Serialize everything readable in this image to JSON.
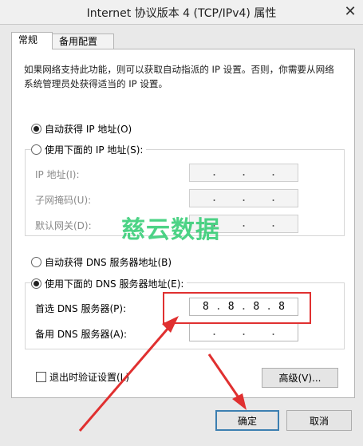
{
  "window": {
    "title": "Internet 协议版本 4 (TCP/IPv4) 属性",
    "close_glyph": "✕"
  },
  "tabs": [
    {
      "label": "常规",
      "active": true
    },
    {
      "label": "备用配置",
      "active": false
    }
  ],
  "description": "如果网络支持此功能，则可以获取自动指派的 IP 设置。否则，你需要从网络系统管理员处获得适当的 IP 设置。",
  "ip": {
    "auto_label": "自动获得 IP 地址(O)",
    "auto_selected": true,
    "manual_label": "使用下面的 IP 地址(S):",
    "manual_selected": false,
    "fields": [
      {
        "label": "IP 地址(I):",
        "octets": [
          "",
          "",
          "",
          ""
        ]
      },
      {
        "label": "子网掩码(U):",
        "octets": [
          "",
          "",
          "",
          ""
        ]
      },
      {
        "label": "默认网关(D):",
        "octets": [
          "",
          "",
          "",
          ""
        ]
      }
    ]
  },
  "dns": {
    "auto_label": "自动获得 DNS 服务器地址(B)",
    "auto_selected": false,
    "manual_label": "使用下面的 DNS 服务器地址(E):",
    "manual_selected": true,
    "preferred": {
      "label": "首选 DNS 服务器(P):",
      "octets": [
        "8",
        "8",
        "8",
        "8"
      ]
    },
    "alternate": {
      "label": "备用 DNS 服务器(A):",
      "octets": [
        "",
        "",
        "",
        ""
      ]
    }
  },
  "validate_label": "退出时验证设置(L)",
  "advanced_label": "高级(V)...",
  "ok_label": "确定",
  "cancel_label": "取消",
  "watermark": "慈云数据",
  "colors": {
    "annotation": "#e03030",
    "watermark": "#2ecc71",
    "default_button": "#3c7fb1"
  }
}
